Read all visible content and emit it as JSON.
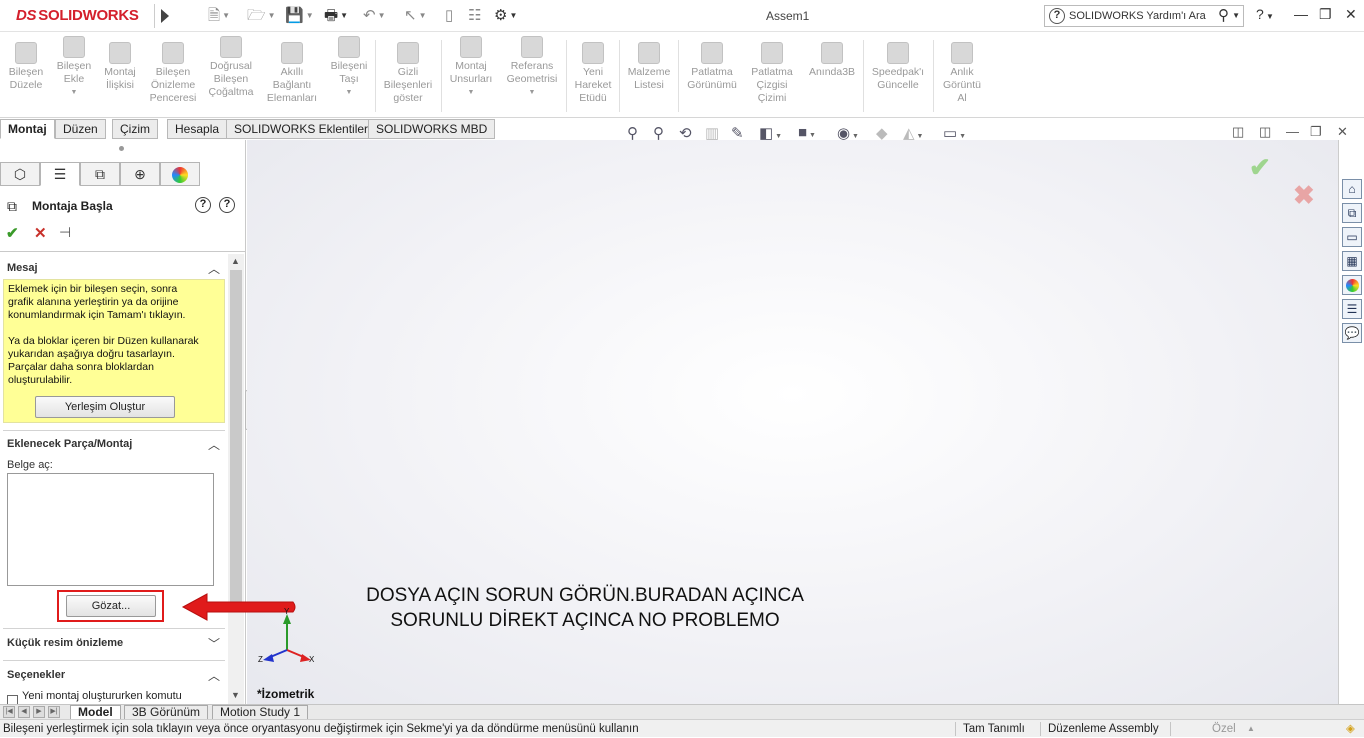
{
  "app": {
    "logo_ds": "DS",
    "logo_text": "SOLIDWORKS",
    "document_title": "Assem1",
    "help_search_placeholder": "SOLIDWORKS Yardım'ı Ara"
  },
  "quick_access": [
    {
      "icon": "new-document-icon"
    },
    {
      "icon": "open-folder-icon"
    },
    {
      "icon": "save-icon"
    },
    {
      "icon": "print-icon"
    },
    {
      "icon": "undo-icon"
    },
    {
      "icon": "select-pointer-icon"
    },
    {
      "icon": "traffic-light-icon"
    },
    {
      "icon": "file-properties-icon"
    },
    {
      "icon": "options-gear-icon"
    }
  ],
  "command_manager": [
    {
      "label": "Bileşen\nDüzele"
    },
    {
      "label": "Bileşen\nEkle"
    },
    {
      "label": "Montaj\nİlişkisi"
    },
    {
      "label": "Bileşen\nÖnizleme\nPenceresi"
    },
    {
      "label": "Doğrusal\nBileşen\nÇoğaltma"
    },
    {
      "label": "Akıllı\nBağlantı\nElemanları"
    },
    {
      "label": "Bileşeni\nTaşı"
    },
    {
      "label": "Gizli\nBileşenleri\ngöster"
    },
    {
      "label": "Montaj\nUnsurları"
    },
    {
      "label": "Referans\nGeometrisi"
    },
    {
      "label": "Yeni\nHareket\nEtüdü"
    },
    {
      "label": "Malzeme\nListesi"
    },
    {
      "label": "Patlatma\nGörünümü"
    },
    {
      "label": "Patlatma\nÇizgisi\nÇizimi"
    },
    {
      "label": "Anında3B"
    },
    {
      "label": "Speedpak'ı\nGüncelle"
    },
    {
      "label": "Anlık\nGörüntü\nAl"
    }
  ],
  "tabs": [
    "Montaj",
    "Düzen",
    "Çizim",
    "Hesapla",
    "SOLIDWORKS Eklentileri",
    "SOLIDWORKS MBD"
  ],
  "property_manager": {
    "title": "Montaja Başla",
    "message_group": {
      "title": "Mesaj",
      "paragraph1": "Eklemek için bir bileşen seçin, sonra\ngrafik alanına yerleştirin ya da orijine\nkonumlandırmak için Tamam'ı tıklayın.",
      "paragraph2": "Ya da bloklar içeren bir Düzen kullanarak\nyukarıdan aşağıya doğru tasarlayın.\nParçalar daha sonra bloklardan\noluşturulabilir.",
      "button": "Yerleşim Oluştur"
    },
    "parts_group": {
      "title": "Eklenecek Parça/Montaj",
      "open_label": "Belge aç:",
      "browse_button": "Gözat..."
    },
    "thumbnail_group": {
      "title": "Küçük resim önizleme"
    },
    "options_group": {
      "title": "Seçenekler",
      "checkbox_label": "Yeni montaj oluştururken komutu"
    }
  },
  "graphics": {
    "annotation_line1": "DOSYA AÇIN SORUN GÖRÜN.BURADAN AÇINCA",
    "annotation_line2": "SORUNLU DİREKT AÇINCA NO PROBLEMO",
    "view_label": "*İzometrik",
    "axis_x": "X",
    "axis_y": "Y",
    "axis_z": "Z"
  },
  "bottom_tabs": [
    "Model",
    "3B Görünüm",
    "Motion Study 1"
  ],
  "status_bar": {
    "message": "Bileşeni yerleştirmek için sola tıklayın veya önce oryantasyonu değiştirmek için Sekme'yi ya da döndürme menüsünü kullanın",
    "definition": "Tam Tanımlı",
    "mode": "Düzenleme Assembly",
    "custom": "Özel"
  },
  "colors": {
    "brand_red": "#d4202c",
    "message_yellow": "#ffff96",
    "highlight_red": "#e01b1b",
    "ok_green": "#3a9a2a"
  }
}
